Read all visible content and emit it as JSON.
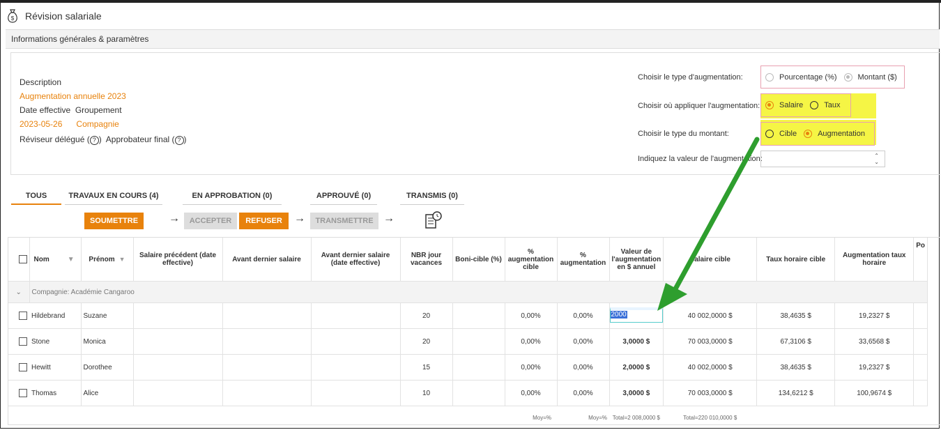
{
  "window": {
    "title": "Révision salariale",
    "icon": "money-bag-icon"
  },
  "section": {
    "title": "Informations générales & paramètres"
  },
  "info": {
    "description_label": "Description",
    "description_value": "Augmentation annuelle 2023",
    "date_label": "Date effective",
    "group_label": "Groupement",
    "date_value": "2023-05-26",
    "group_value": "Compagnie",
    "reviewer_label": "Réviseur délégué",
    "approver_label": "Approbateur final",
    "help_glyph": "?"
  },
  "settings": {
    "type_label": "Choisir le type d'augmentation:",
    "type_opt1": "Pourcentage (%)",
    "type_opt2": "Montant ($)",
    "apply_label": "Choisir où appliquer l'augmentation:",
    "apply_opt1": "Salaire",
    "apply_opt2": "Taux",
    "amount_label": "Choisir le type du montant:",
    "amount_opt1": "Cible",
    "amount_opt2": "Augmentation",
    "value_label": "Indiquez la valeur de l'augmentation:",
    "value_input": ""
  },
  "tabs": [
    "TOUS",
    "TRAVAUX EN COURS (4)",
    "EN APPROBATION (0)",
    "APPROUVÉ (0)",
    "TRANSMIS (0)"
  ],
  "buttons": {
    "submit": "SOUMETTRE",
    "accept": "ACCEPTER",
    "refuse": "REFUSER",
    "transmit": "TRANSMETTRE"
  },
  "table": {
    "headers": [
      "Nom",
      "Prénom",
      "Salaire précédent (date effective)",
      "Avant dernier salaire",
      "Avant dernier salaire (date effective)",
      "NBR jour vacances",
      "Boni-cible (%)",
      "% augmentation cible",
      "% augmentation",
      "Valeur de l'augmentation en $ annuel",
      "Salaire cible",
      "Taux horaire cible",
      "Augmentation taux horaire",
      "Po"
    ],
    "group_row": "Compagnie: Académie Cangaroo",
    "rows": [
      {
        "nom": "Hildebrand",
        "prenom": "Suzane",
        "vac": "20",
        "pct_cible": "0,00%",
        "pct": "0,00%",
        "valeur": "2000",
        "sal_cible": "40 002,0000 $",
        "taux_cible": "38,4635 $",
        "aug_taux": "19,2327 $"
      },
      {
        "nom": "Stone",
        "prenom": "Monica",
        "vac": "20",
        "pct_cible": "0,00%",
        "pct": "0,00%",
        "valeur": "3,0000 $",
        "sal_cible": "70 003,0000 $",
        "taux_cible": "67,3106 $",
        "aug_taux": "33,6568 $"
      },
      {
        "nom": "Hewitt",
        "prenom": "Dorothee",
        "vac": "15",
        "pct_cible": "0,00%",
        "pct": "0,00%",
        "valeur": "2,0000 $",
        "sal_cible": "40 002,0000 $",
        "taux_cible": "38,4635 $",
        "aug_taux": "19,2327 $"
      },
      {
        "nom": "Thomas",
        "prenom": "Alice",
        "vac": "10",
        "pct_cible": "0,00%",
        "pct": "0,00%",
        "valeur": "3,0000 $",
        "sal_cible": "70 003,0000 $",
        "taux_cible": "134,6212 $",
        "aug_taux": "100,9674 $"
      }
    ],
    "footer": {
      "moy1": "Moy=%",
      "moy2": "Moy=%",
      "total_valeur": "Total=2 008,0000 $",
      "total_salaire": "Total=220 010,0000 $"
    }
  },
  "colors": {
    "accent": "#e8820c",
    "highlight": "#f5f545",
    "annotation_arrow": "#2e9e2e"
  }
}
